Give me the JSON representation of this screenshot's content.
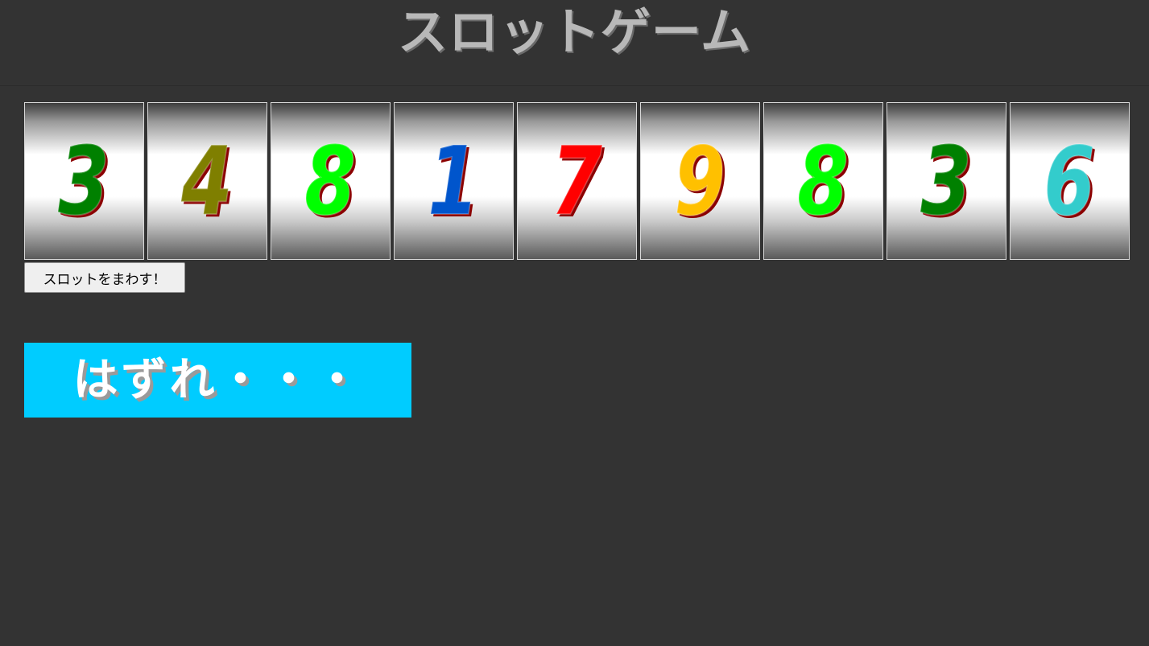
{
  "header": {
    "title": "スロットゲーム"
  },
  "reels": [
    {
      "digit": "3",
      "color": "#008000"
    },
    {
      "digit": "4",
      "color": "#7f7f00"
    },
    {
      "digit": "8",
      "color": "#00ff00"
    },
    {
      "digit": "1",
      "color": "#0055cc"
    },
    {
      "digit": "7",
      "color": "#ff0000"
    },
    {
      "digit": "9",
      "color": "#ffc000"
    },
    {
      "digit": "8",
      "color": "#00ff00"
    },
    {
      "digit": "3",
      "color": "#008000"
    },
    {
      "digit": "6",
      "color": "#33cccc"
    }
  ],
  "controls": {
    "spin_label": "スロットをまわす！"
  },
  "result": {
    "text": "はずれ・・・",
    "background": "#00ccff"
  }
}
